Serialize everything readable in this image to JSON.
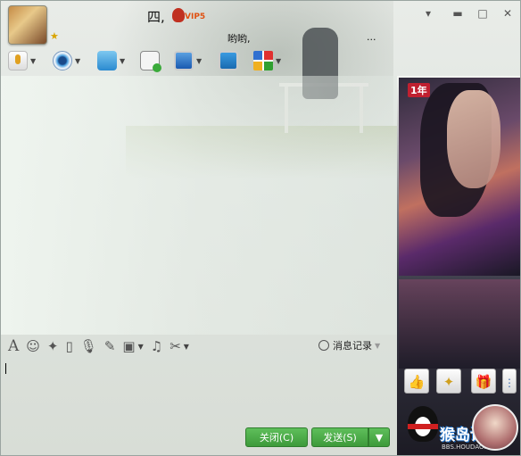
{
  "header": {
    "nickname": "四,",
    "vip_label": "VIP5",
    "status_message": "哟哟,",
    "more": "..."
  },
  "window_controls": {
    "menu": "▾",
    "minimize": "▬",
    "maximize": "□",
    "close": "✕"
  },
  "toolbar": {
    "items": [
      "voice-call",
      "video-call",
      "send-file",
      "new-discussion",
      "remote-assist",
      "share-screen",
      "apps"
    ]
  },
  "format_bar": {
    "history_label": "消息记录"
  },
  "actions": {
    "close_label": "关闭(C)",
    "send_label": "发送(S)"
  },
  "profile_panel": {
    "year_badge": "1年",
    "logo_text": "猴岛论坛",
    "logo_url_text": "BBS.HOUDAO.COM"
  },
  "colors": {
    "send_green": "#3d9a3a",
    "vip_orange": "#e05010"
  }
}
